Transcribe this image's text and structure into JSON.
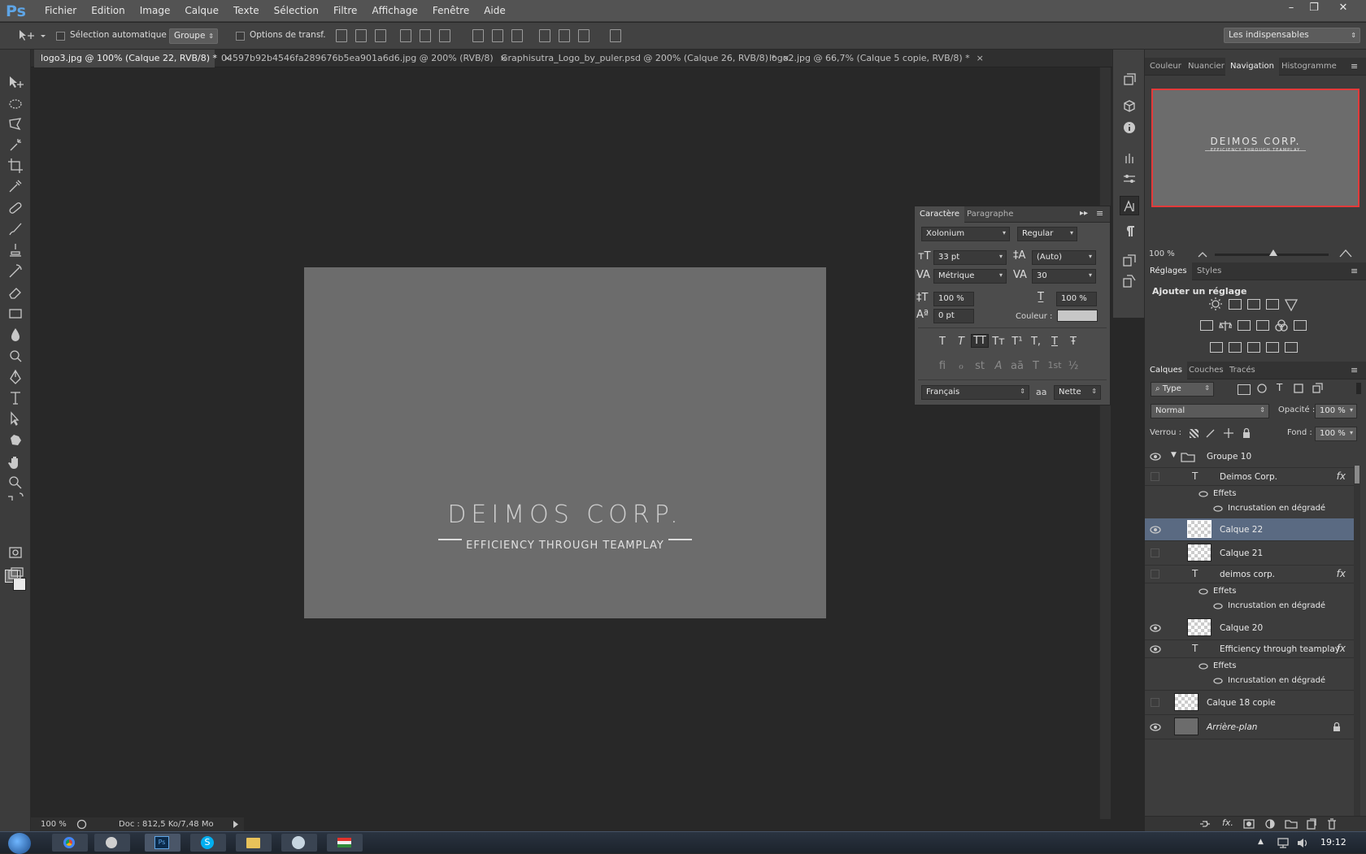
{
  "app": {
    "logo": "Ps"
  },
  "menu": [
    "Fichier",
    "Edition",
    "Image",
    "Calque",
    "Texte",
    "Sélection",
    "Filtre",
    "Affichage",
    "Fenêtre",
    "Aide"
  ],
  "window_controls": {
    "minimize": "–",
    "restore": "❐",
    "close": "✕"
  },
  "options": {
    "auto_select_label": "Sélection automatique :",
    "auto_select_value": "Groupe",
    "transform_label": "Options de transf.",
    "workspace": "Les indispensables"
  },
  "tabs": [
    "logo3.jpg @ 100% (Calque 22, RVB/8) *",
    "04597b92b4546fa289676b5ea901a6d6.jpg @ 200% (RVB/8)",
    "Graphisutra_Logo_by_puler.psd @ 200% (Calque 26, RVB/8) *",
    "logo2.jpg @ 66,7% (Calque 5 copie, RVB/8) *"
  ],
  "tab_close": "×",
  "document": {
    "title": "DEIMOS CORP.",
    "subtitle": "EFFICIENCY THROUGH TEAMPLAY"
  },
  "status": {
    "zoom": "100 %",
    "doc": "Doc : 812,5 Ko/7,48 Mo"
  },
  "character_panel": {
    "tabs": [
      "Caractère",
      "Paragraphe"
    ],
    "font": "Xolonium",
    "style": "Regular",
    "size": "33 pt",
    "leading": "(Auto)",
    "kerning": "Métrique",
    "tracking": "30",
    "vscale": "100 %",
    "hscale": "100 %",
    "baseline": "0 pt",
    "color_label": "Couleur :",
    "language": "Français",
    "antialias_icon": "aa",
    "antialias": "Nette",
    "type_glyphs": [
      "T",
      "T",
      "TT",
      "Tт",
      "T¹",
      "T,",
      "T",
      "Ŧ"
    ],
    "ot_glyphs": [
      "ﬁ",
      "ℴ",
      "st",
      "A",
      "aā",
      "T",
      "1st",
      "½"
    ]
  },
  "nav_panel": {
    "tabs": [
      "Couleur",
      "Nuancier",
      "Navigation",
      "Histogramme"
    ],
    "preview_title": "DEIMOS CORP.",
    "preview_subtitle": "EFFICIENCY THROUGH TEAMPLAY",
    "zoom": "100 %"
  },
  "adjust_panel": {
    "tabs": [
      "Réglages",
      "Styles"
    ],
    "heading": "Ajouter un réglage"
  },
  "layers_panel": {
    "tabs": [
      "Calques",
      "Couches",
      "Tracés"
    ],
    "filter": "Type",
    "blend": "Normal",
    "opacity_label": "Opacité :",
    "opacity": "100 %",
    "lock_label": "Verrou :",
    "fill_label": "Fond :",
    "fill": "100 %",
    "layers": [
      {
        "name": "Groupe 10",
        "type": "group"
      },
      {
        "name": "Deimos Corp.",
        "type": "text",
        "fx": "fx"
      },
      {
        "name": "Effets",
        "type": "effects"
      },
      {
        "name": "Incrustation en dégradé",
        "type": "effect"
      },
      {
        "name": "Calque 22",
        "type": "pixel",
        "selected": true
      },
      {
        "name": "Calque 21",
        "type": "pixel"
      },
      {
        "name": "deimos corp.",
        "type": "text",
        "fx": "fx"
      },
      {
        "name": "Effets",
        "type": "effects"
      },
      {
        "name": "Incrustation en dégradé",
        "type": "effect"
      },
      {
        "name": "Calque 20",
        "type": "pixel"
      },
      {
        "name": "Efficiency through teamplay",
        "type": "text",
        "fx": "fx"
      },
      {
        "name": "Effets",
        "type": "effects"
      },
      {
        "name": "Incrustation en dégradé",
        "type": "effect"
      },
      {
        "name": "Calque 18 copie",
        "type": "pixel"
      },
      {
        "name": "Arrière-plan",
        "type": "background"
      }
    ]
  },
  "taskbar": {
    "clock": "19:12",
    "apps": [
      "Chrome",
      "Media",
      "Photoshop",
      "Skype",
      "Explorer",
      "Steam",
      "Flag"
    ]
  },
  "colors": {
    "accent": "#5ea5e6",
    "selection": "#5a6a82",
    "nav_frame": "#e33a3a"
  }
}
